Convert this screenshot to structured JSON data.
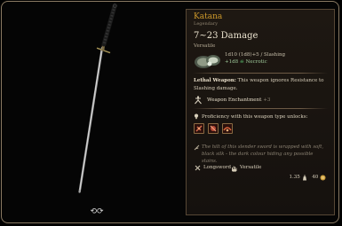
{
  "item": {
    "name": "Katana",
    "rarity": "Legendary",
    "damage_range": "7~23 Damage",
    "weapon_property": "Versatile",
    "damage_lines": [
      {
        "dice": "1d10 (1d8)+5",
        "type": "Slashing"
      },
      {
        "dice": "+1d8",
        "type": "Necrotic"
      }
    ],
    "lethal": {
      "title": "Lethal Weapon:",
      "text": "This weapon ignores Resistance to Slashing damage."
    },
    "enchantment": {
      "label": "Weapon Enchantment",
      "value": "+3"
    },
    "proficiency_text": "Proficiency with this weapon type unlocks:",
    "flavor_text": "The hilt of this slender sword is wrapped with soft, black silk - the dark colour hiding any possible stains.",
    "tags": [
      "Longsword",
      "Versatile"
    ],
    "weight": "1.35",
    "value": "40"
  },
  "colors": {
    "accent": "#cf9a2b",
    "border": "#8a7a63",
    "necrotic": "#65d47b"
  },
  "icons": {
    "rotate": "rotate-arrows-icon",
    "slashing": "slash-icon",
    "necrotic": "necrotic-skull-icon",
    "enchantment": "enchantment-icon",
    "proficiency": "lightbulb-icon",
    "flavor": "quill-icon",
    "longsword": "crossed-swords-icon",
    "versatile": "hand-icon",
    "weight": "weight-icon",
    "gold": "gold-coin-icon"
  }
}
